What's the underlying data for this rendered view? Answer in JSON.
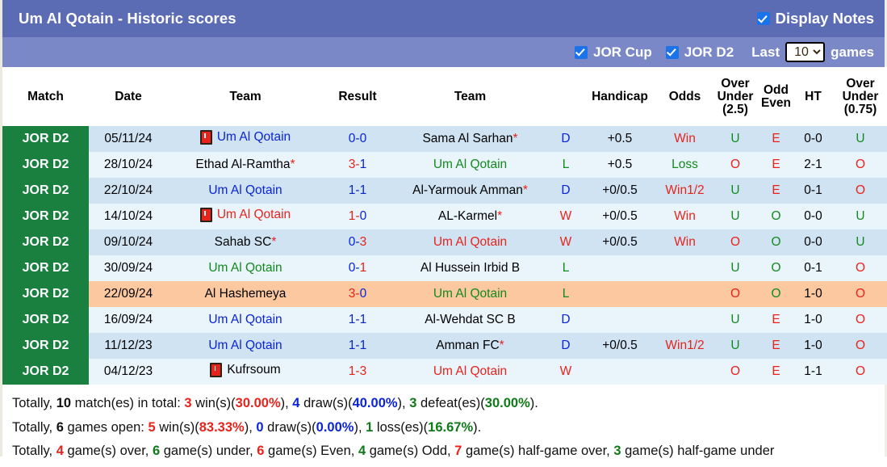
{
  "header": {
    "title": "Um Al Qotain - Historic scores",
    "display_notes_label": "Display Notes",
    "jor_cup_label": "JOR Cup",
    "jor_d2_label": "JOR D2",
    "last_label": "Last",
    "games_label": "games",
    "games_count": "10",
    "accent_blue": "#5b6cb4",
    "accent_blue_light": "#7b88c7",
    "checkbox_blue": "#1a73e8"
  },
  "table": {
    "columns": [
      "Match",
      "Date",
      "Team",
      "Result",
      "Team",
      "Handicap",
      "Odds",
      "Over Under (2.5)",
      "Odd Even",
      "HT",
      "Over Under (0.75)"
    ],
    "columns_multiline": {
      "ou25_l1": "Over",
      "ou25_l2": "Under",
      "ou25_l3": "(2.5)",
      "oe_l1": "Odd",
      "oe_l2": "Even",
      "ou075_l1": "Over",
      "ou075_l2": "Under",
      "ou075_l3": "(0.75)"
    },
    "rows": [
      {
        "league": "JOR D2",
        "date": "05/11/24",
        "home": "Um Al Qotain",
        "home_color": "#0b24d6",
        "home_card": true,
        "home_star": false,
        "score_a": "0",
        "score_b": "0",
        "score_a_color": "#0b24d6",
        "score_b_color": "#0b24d6",
        "away": "Sama Al Sarhan",
        "away_color": "#000000",
        "away_card": false,
        "away_star": true,
        "wdl": "D",
        "wdl_color": "#0b24d6",
        "handicap": "+0.5",
        "odds": "Win",
        "odds_color": "#e8231c",
        "ou25": "U",
        "ou25_color": "#138a1d",
        "oe": "E",
        "oe_color": "#e8231c",
        "ht": "0-0",
        "ou075": "U",
        "ou075_color": "#138a1d",
        "highlight": false
      },
      {
        "league": "JOR D2",
        "date": "28/10/24",
        "home": "Ethad Al-Ramtha",
        "home_color": "#000000",
        "home_card": false,
        "home_star": true,
        "score_a": "3",
        "score_b": "1",
        "score_a_color": "#e8231c",
        "score_b_color": "#0b24d6",
        "away": "Um Al Qotain",
        "away_color": "#138a1d",
        "away_card": false,
        "away_star": false,
        "wdl": "L",
        "wdl_color": "#138a1d",
        "handicap": "+0.5",
        "odds": "Loss",
        "odds_color": "#138a1d",
        "ou25": "O",
        "ou25_color": "#e8231c",
        "oe": "E",
        "oe_color": "#e8231c",
        "ht": "2-1",
        "ou075": "O",
        "ou075_color": "#e8231c",
        "highlight": false
      },
      {
        "league": "JOR D2",
        "date": "22/10/24",
        "home": "Um Al Qotain",
        "home_color": "#0b24d6",
        "home_card": false,
        "home_star": false,
        "score_a": "1",
        "score_b": "1",
        "score_a_color": "#0b24d6",
        "score_b_color": "#0b24d6",
        "away": "Al-Yarmouk Amman",
        "away_color": "#000000",
        "away_card": false,
        "away_star": true,
        "wdl": "D",
        "wdl_color": "#0b24d6",
        "handicap": "+0/0.5",
        "odds": "Win1/2",
        "odds_color": "#e8231c",
        "ou25": "U",
        "ou25_color": "#138a1d",
        "oe": "E",
        "oe_color": "#e8231c",
        "ht": "0-1",
        "ou075": "O",
        "ou075_color": "#e8231c",
        "highlight": false
      },
      {
        "league": "JOR D2",
        "date": "14/10/24",
        "home": "Um Al Qotain",
        "home_color": "#e8231c",
        "home_card": true,
        "home_star": false,
        "score_a": "1",
        "score_b": "0",
        "score_a_color": "#e8231c",
        "score_b_color": "#0b24d6",
        "away": "AL-Karmel",
        "away_color": "#000000",
        "away_card": false,
        "away_star": true,
        "wdl": "W",
        "wdl_color": "#e8231c",
        "handicap": "+0/0.5",
        "odds": "Win",
        "odds_color": "#e8231c",
        "ou25": "U",
        "ou25_color": "#138a1d",
        "oe": "O",
        "oe_color": "#138a1d",
        "ht": "0-0",
        "ou075": "U",
        "ou075_color": "#138a1d",
        "highlight": false
      },
      {
        "league": "JOR D2",
        "date": "09/10/24",
        "home": "Sahab SC",
        "home_color": "#000000",
        "home_card": false,
        "home_star": true,
        "score_a": "0",
        "score_b": "3",
        "score_a_color": "#0b24d6",
        "score_b_color": "#e8231c",
        "away": "Um Al Qotain",
        "away_color": "#e8231c",
        "away_card": false,
        "away_star": false,
        "wdl": "W",
        "wdl_color": "#e8231c",
        "handicap": "+0/0.5",
        "odds": "Win",
        "odds_color": "#e8231c",
        "ou25": "O",
        "ou25_color": "#e8231c",
        "oe": "O",
        "oe_color": "#138a1d",
        "ht": "0-0",
        "ou075": "U",
        "ou075_color": "#138a1d",
        "highlight": false
      },
      {
        "league": "JOR D2",
        "date": "30/09/24",
        "home": "Um Al Qotain",
        "home_color": "#138a1d",
        "home_card": false,
        "home_star": false,
        "score_a": "0",
        "score_b": "1",
        "score_a_color": "#0b24d6",
        "score_b_color": "#e8231c",
        "away": "Al Hussein Irbid B",
        "away_color": "#000000",
        "away_card": false,
        "away_star": false,
        "wdl": "L",
        "wdl_color": "#138a1d",
        "handicap": "",
        "odds": "",
        "odds_color": "#000000",
        "ou25": "U",
        "ou25_color": "#138a1d",
        "oe": "O",
        "oe_color": "#138a1d",
        "ht": "0-1",
        "ou075": "O",
        "ou075_color": "#e8231c",
        "highlight": false
      },
      {
        "league": "JOR D2",
        "date": "22/09/24",
        "home": "Al Hashemeya",
        "home_color": "#000000",
        "home_card": false,
        "home_star": false,
        "score_a": "3",
        "score_b": "0",
        "score_a_color": "#e8231c",
        "score_b_color": "#0b24d6",
        "away": "Um Al Qotain",
        "away_color": "#138a1d",
        "away_card": false,
        "away_star": false,
        "wdl": "L",
        "wdl_color": "#138a1d",
        "handicap": "",
        "odds": "",
        "odds_color": "#000000",
        "ou25": "O",
        "ou25_color": "#e8231c",
        "oe": "O",
        "oe_color": "#138a1d",
        "ht": "1-0",
        "ou075": "O",
        "ou075_color": "#e8231c",
        "highlight": true
      },
      {
        "league": "JOR D2",
        "date": "16/09/24",
        "home": "Um Al Qotain",
        "home_color": "#0b24d6",
        "home_card": false,
        "home_star": false,
        "score_a": "1",
        "score_b": "1",
        "score_a_color": "#0b24d6",
        "score_b_color": "#0b24d6",
        "away": "Al-Wehdat SC B",
        "away_color": "#000000",
        "away_card": false,
        "away_star": false,
        "wdl": "D",
        "wdl_color": "#0b24d6",
        "handicap": "",
        "odds": "",
        "odds_color": "#000000",
        "ou25": "U",
        "ou25_color": "#138a1d",
        "oe": "E",
        "oe_color": "#e8231c",
        "ht": "1-0",
        "ou075": "O",
        "ou075_color": "#e8231c",
        "highlight": false
      },
      {
        "league": "JOR D2",
        "date": "11/12/23",
        "home": "Um Al Qotain",
        "home_color": "#0b24d6",
        "home_card": false,
        "home_star": false,
        "score_a": "1",
        "score_b": "1",
        "score_a_color": "#0b24d6",
        "score_b_color": "#0b24d6",
        "away": "Amman FC",
        "away_color": "#000000",
        "away_card": false,
        "away_star": true,
        "wdl": "D",
        "wdl_color": "#0b24d6",
        "handicap": "+0/0.5",
        "odds": "Win1/2",
        "odds_color": "#e8231c",
        "ou25": "U",
        "ou25_color": "#138a1d",
        "oe": "E",
        "oe_color": "#e8231c",
        "ht": "1-0",
        "ou075": "O",
        "ou075_color": "#e8231c",
        "highlight": false
      },
      {
        "league": "JOR D2",
        "date": "04/12/23",
        "home": "Kufrsoum",
        "home_color": "#000000",
        "home_card": true,
        "home_star": false,
        "score_a": "1",
        "score_b": "3",
        "score_a_color": "#e8231c",
        "score_b_color": "#e8231c",
        "away": "Um Al Qotain",
        "away_color": "#e8231c",
        "away_card": false,
        "away_star": false,
        "wdl": "W",
        "wdl_color": "#e8231c",
        "handicap": "",
        "odds": "",
        "odds_color": "#000000",
        "ou25": "O",
        "ou25_color": "#e8231c",
        "oe": "E",
        "oe_color": "#e8231c",
        "ht": "1-1",
        "ou075": "O",
        "ou075_color": "#e8231c",
        "highlight": false
      }
    ]
  },
  "summary": {
    "line1": {
      "t1": "Totally, ",
      "n1": "10",
      "t2": " match(es) in total: ",
      "n2": "3",
      "t3": " win(s)(",
      "p2": "30.00%",
      "t4": "), ",
      "n3": "4",
      "t5": " draw(s)(",
      "p3": "40.00%",
      "t6": "), ",
      "n4": "3",
      "t7": " defeat(es)(",
      "p4": "30.00%",
      "t8": ")."
    },
    "line2": {
      "t1": "Totally, ",
      "n1": "6",
      "t2": " games open: ",
      "n2": "5",
      "t3": " win(s)(",
      "p2": "83.33%",
      "t4": "), ",
      "n3": "0",
      "t5": " draw(s)(",
      "p3": "0.00%",
      "t6": "), ",
      "n4": "1",
      "t7": " loss(es)(",
      "p4": "16.67%",
      "t8": ")."
    },
    "line3": {
      "t1": "Totally, ",
      "n1": "4",
      "t2": " game(s) over, ",
      "n2": "6",
      "t3": " game(s) under, ",
      "n3": "6",
      "t4": " game(s) Even, ",
      "n4": "4",
      "t5": " game(s) Odd, ",
      "n5": "7",
      "t6": " game(s) half-game over, ",
      "n6": "3",
      "t7": " game(s) half-game under"
    }
  }
}
